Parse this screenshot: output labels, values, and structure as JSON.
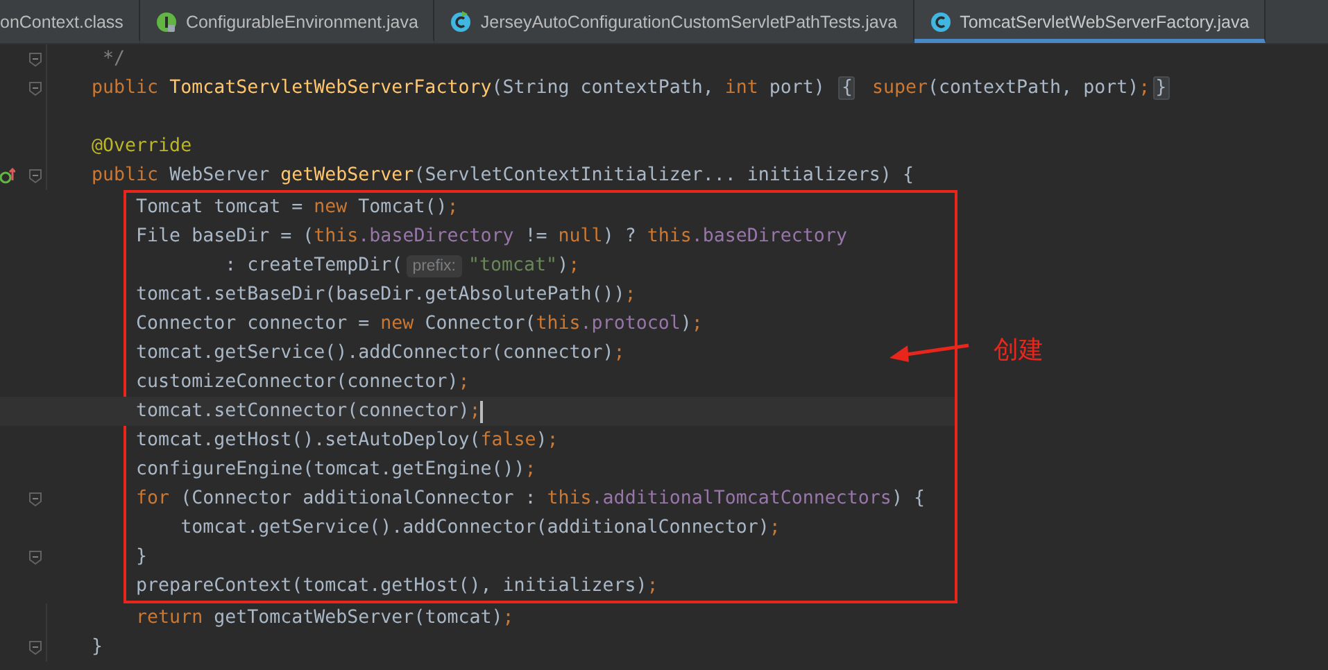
{
  "tabs": [
    {
      "label": "onContext.class",
      "kind": "file",
      "selected": false
    },
    {
      "label": "ConfigurableEnvironment.java",
      "kind": "interface",
      "selected": false
    },
    {
      "label": "JerseyAutoConfigurationCustomServletPathTests.java",
      "kind": "test-class",
      "selected": false
    },
    {
      "label": "TomcatServletWebServerFactory.java",
      "kind": "class",
      "selected": true
    }
  ],
  "editor": {
    "lines_before": [
      {
        "fold": true,
        "override": false,
        "current": false,
        "tokens": [
          {
            "kind": "cm",
            "t": "     */"
          }
        ]
      },
      {
        "fold": true,
        "override": false,
        "current": false,
        "tokens": [
          {
            "kind": "kw",
            "t": "    public "
          },
          {
            "kind": "fn",
            "t": "TomcatServletWebServerFactory"
          },
          {
            "kind": "p",
            "t": "(String contextPath, "
          },
          {
            "kind": "kw",
            "t": "int "
          },
          {
            "kind": "p",
            "t": "port) "
          },
          {
            "kind": "fb",
            "t": "{"
          },
          {
            "kind": "kw",
            "t": " super"
          },
          {
            "kind": "p",
            "t": "(contextPath, port)"
          },
          {
            "kind": "kw",
            "t": ";"
          },
          {
            "kind": "fb",
            "t": "}"
          }
        ]
      },
      {
        "fold": false,
        "override": false,
        "current": false
      },
      {
        "fold": false,
        "override": false,
        "current": false,
        "tokens": [
          {
            "kind": "ann",
            "t": "    @Override"
          }
        ]
      },
      {
        "fold": true,
        "override": true,
        "current": false,
        "tokens": [
          {
            "kind": "kw",
            "t": "    public "
          },
          {
            "kind": "p",
            "t": "WebServer "
          },
          {
            "kind": "fn",
            "t": "getWebServer"
          },
          {
            "kind": "p",
            "t": "(ServletContextInitializer... initializers) {"
          }
        ]
      }
    ],
    "marked_block": {
      "note": "创建",
      "lines": [
        {
          "fold": false,
          "override": false,
          "current": false,
          "tokens": [
            {
              "kind": "p",
              "t": "        Tomcat tomcat = "
            },
            {
              "kind": "kw",
              "t": "new "
            },
            {
              "kind": "p",
              "t": "Tomcat()"
            },
            {
              "kind": "kw",
              "t": ";"
            }
          ]
        },
        {
          "fold": false,
          "override": false,
          "current": false,
          "tokens": [
            {
              "kind": "p",
              "t": "        File baseDir = ("
            },
            {
              "kind": "kw",
              "t": "this"
            },
            {
              "kind": "fld",
              "t": ".baseDirectory"
            },
            {
              "kind": "p",
              "t": " != "
            },
            {
              "kind": "kw",
              "t": "null"
            },
            {
              "kind": "p",
              "t": ") ? "
            },
            {
              "kind": "kw",
              "t": "this"
            },
            {
              "kind": "fld",
              "t": ".baseDirectory"
            }
          ]
        },
        {
          "fold": false,
          "override": false,
          "current": false,
          "tokens": [
            {
              "kind": "p",
              "t": "                : createTempDir("
            },
            {
              "kind": "hint",
              "t": "prefix:"
            },
            {
              "kind": "str",
              "t": "\"tomcat\""
            },
            {
              "kind": "p",
              "t": ")"
            },
            {
              "kind": "kw",
              "t": ";"
            }
          ]
        },
        {
          "fold": false,
          "override": false,
          "current": false,
          "tokens": [
            {
              "kind": "p",
              "t": "        tomcat.setBaseDir(baseDir.getAbsolutePath())"
            },
            {
              "kind": "kw",
              "t": ";"
            }
          ]
        },
        {
          "fold": false,
          "override": false,
          "current": false,
          "tokens": [
            {
              "kind": "p",
              "t": "        Connector connector = "
            },
            {
              "kind": "kw",
              "t": "new "
            },
            {
              "kind": "p",
              "t": "Connector("
            },
            {
              "kind": "kw",
              "t": "this"
            },
            {
              "kind": "fld",
              "t": ".protocol"
            },
            {
              "kind": "p",
              "t": ")"
            },
            {
              "kind": "kw",
              "t": ";"
            }
          ]
        },
        {
          "fold": false,
          "override": false,
          "current": false,
          "tokens": [
            {
              "kind": "p",
              "t": "        tomcat.getService().addConnector(connector)"
            },
            {
              "kind": "kw",
              "t": ";"
            }
          ]
        },
        {
          "fold": false,
          "override": false,
          "current": false,
          "tokens": [
            {
              "kind": "p",
              "t": "        customizeConnector(connector)"
            },
            {
              "kind": "kw",
              "t": ";"
            }
          ]
        },
        {
          "fold": false,
          "override": false,
          "current": true,
          "tokens": [
            {
              "kind": "p",
              "t": "        tomcat.setConnector(connector)"
            },
            {
              "kind": "kw",
              "t": ";"
            }
          ]
        },
        {
          "fold": false,
          "override": false,
          "current": false,
          "tokens": [
            {
              "kind": "p",
              "t": "        tomcat.getHost().setAutoDeploy("
            },
            {
              "kind": "kw",
              "t": "false"
            },
            {
              "kind": "p",
              "t": ")"
            },
            {
              "kind": "kw",
              "t": ";"
            }
          ]
        },
        {
          "fold": false,
          "override": false,
          "current": false,
          "tokens": [
            {
              "kind": "p",
              "t": "        configureEngine(tomcat.getEngine())"
            },
            {
              "kind": "kw",
              "t": ";"
            }
          ]
        },
        {
          "fold": true,
          "override": false,
          "current": false,
          "tokens": [
            {
              "kind": "kw",
              "t": "        for "
            },
            {
              "kind": "p",
              "t": "(Connector additionalConnector : "
            },
            {
              "kind": "kw",
              "t": "this"
            },
            {
              "kind": "fld",
              "t": ".additionalTomcatConnectors"
            },
            {
              "kind": "p",
              "t": ") {"
            }
          ]
        },
        {
          "fold": false,
          "override": false,
          "current": false,
          "tokens": [
            {
              "kind": "p",
              "t": "            tomcat.getService().addConnector(additionalConnector)"
            },
            {
              "kind": "kw",
              "t": ";"
            }
          ]
        },
        {
          "fold": true,
          "override": false,
          "current": false,
          "tokens": [
            {
              "kind": "p",
              "t": "        }"
            }
          ]
        },
        {
          "fold": false,
          "override": false,
          "current": false,
          "tokens": [
            {
              "kind": "p",
              "t": "        prepareContext(tomcat.getHost(), initializers)"
            },
            {
              "kind": "kw",
              "t": ";"
            }
          ]
        }
      ]
    },
    "lines_after": [
      {
        "fold": false,
        "override": false,
        "current": false,
        "tokens": [
          {
            "kind": "kw",
            "t": "        return "
          },
          {
            "kind": "p",
            "t": "getTomcatWebServer(tomcat)"
          },
          {
            "kind": "kw",
            "t": ";"
          }
        ]
      },
      {
        "fold": true,
        "override": false,
        "current": false,
        "tokens": [
          {
            "kind": "p",
            "t": "    }"
          }
        ]
      }
    ]
  }
}
